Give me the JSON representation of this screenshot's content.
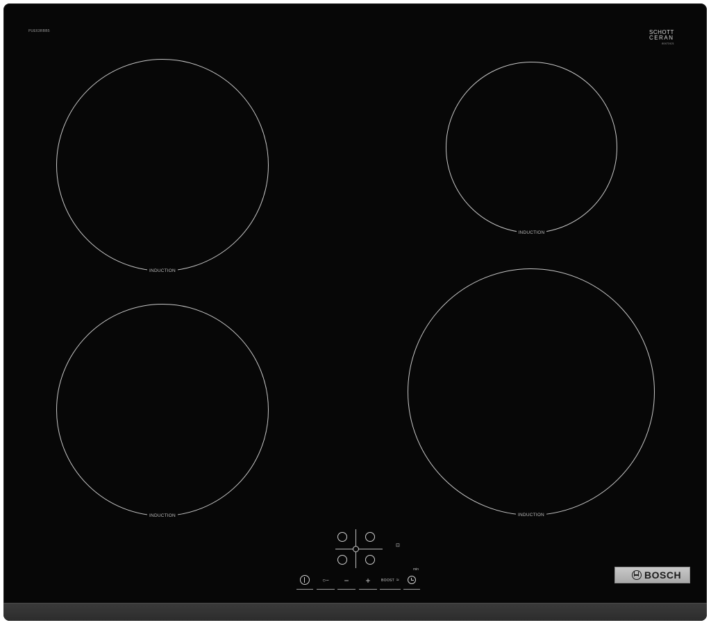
{
  "hob": {
    "model_number": "PUE63RBB5",
    "ceran_brand_line1": "SCHOTT",
    "ceran_brand_line2": "CERAN",
    "ceran_code": "80472421",
    "zone_label": "INDUCTION",
    "zones": [
      {
        "id": "front-left",
        "label": "INDUCTION"
      },
      {
        "id": "back-left",
        "label": "INDUCTION"
      },
      {
        "id": "back-right",
        "label": "INDUCTION"
      },
      {
        "id": "front-right",
        "label": "INDUCTION"
      }
    ],
    "controls": {
      "power_icon": "power-icon",
      "key_symbol": "○−",
      "minus_symbol": "−",
      "plus_symbol": "+",
      "boost_label": "BOOST",
      "boost_symbol": "≈",
      "timer_icon": "timer-icon",
      "min_label": "min",
      "lock_symbol": "⊡"
    },
    "brand": "BOSCH",
    "colors": {
      "glass": "#070707",
      "markings": "#c9c9c9",
      "frame": "#333333",
      "brand_plate": "#b9b9b9"
    }
  }
}
